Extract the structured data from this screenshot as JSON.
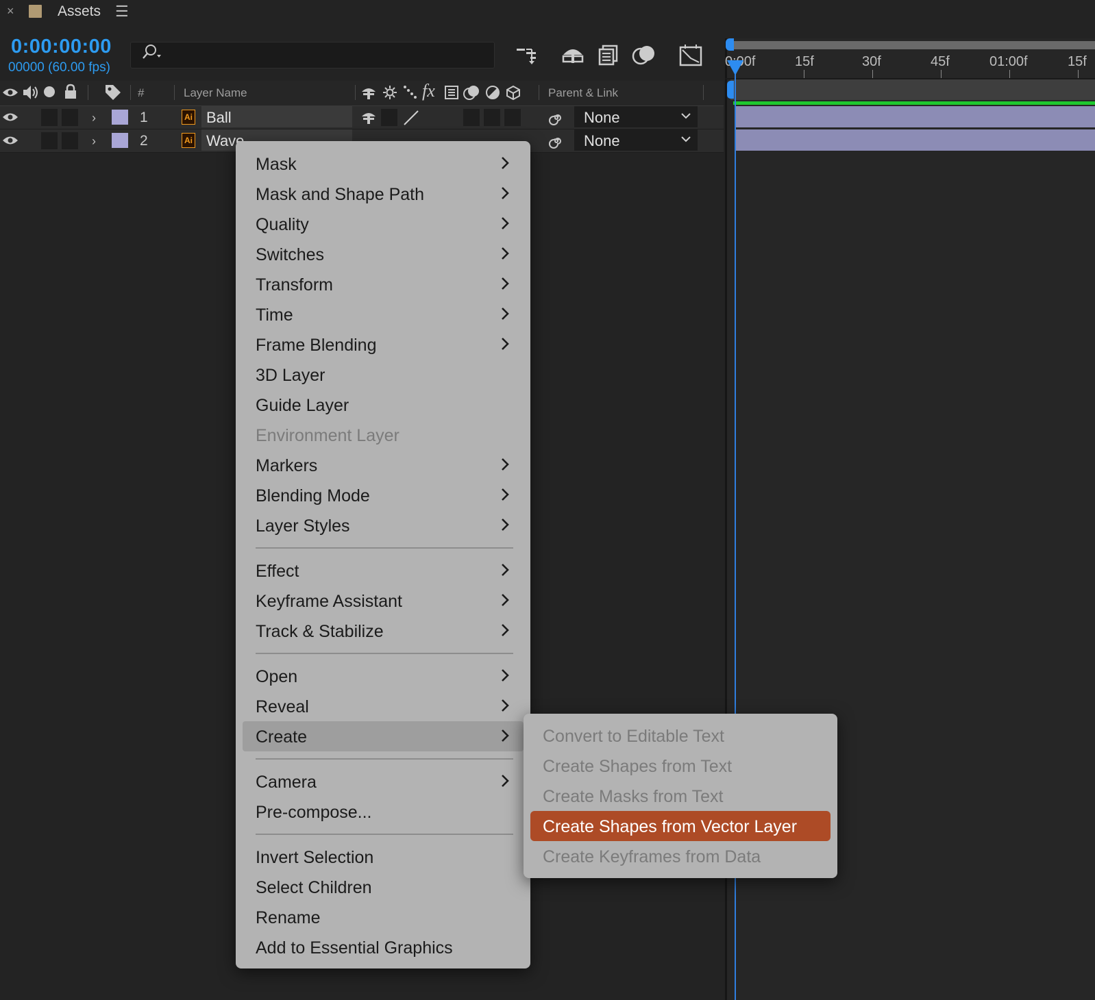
{
  "tab": {
    "title": "Assets",
    "close": "×",
    "menu": "☰"
  },
  "time": {
    "timecode": "0:00:00:00",
    "frames": "00000 (60.00 fps)"
  },
  "search": {
    "placeholder": "",
    "value": ""
  },
  "columns": {
    "hash": "#",
    "layer_name": "Layer Name",
    "parent_link": "Parent & Link"
  },
  "layers": [
    {
      "num": "1",
      "name": "Ball",
      "parent": "None",
      "label_color": "#a9a6d6"
    },
    {
      "num": "2",
      "name": "Wave",
      "parent": "None",
      "label_color": "#a9a6d6"
    }
  ],
  "ruler": [
    "0:00f",
    "15f",
    "30f",
    "45f",
    "01:00f",
    "15f"
  ],
  "menu": {
    "items": [
      {
        "label": "Mask",
        "submenu": true
      },
      {
        "label": "Mask and Shape Path",
        "submenu": true
      },
      {
        "label": "Quality",
        "submenu": true
      },
      {
        "label": "Switches",
        "submenu": true
      },
      {
        "label": "Transform",
        "submenu": true
      },
      {
        "label": "Time",
        "submenu": true
      },
      {
        "label": "Frame Blending",
        "submenu": true
      },
      {
        "label": "3D Layer",
        "submenu": false
      },
      {
        "label": "Guide Layer",
        "submenu": false
      },
      {
        "label": "Environment Layer",
        "submenu": false,
        "disabled": true
      },
      {
        "label": "Markers",
        "submenu": true
      },
      {
        "label": "Blending Mode",
        "submenu": true
      },
      {
        "label": "Layer Styles",
        "submenu": true
      },
      {
        "label": "Effect",
        "submenu": true
      },
      {
        "label": "Keyframe Assistant",
        "submenu": true
      },
      {
        "label": "Track & Stabilize",
        "submenu": true
      },
      {
        "label": "Open",
        "submenu": true
      },
      {
        "label": "Reveal",
        "submenu": true
      },
      {
        "label": "Create",
        "submenu": true,
        "highlighted": true
      },
      {
        "label": "Camera",
        "submenu": true
      },
      {
        "label": "Pre-compose...",
        "submenu": false
      },
      {
        "label": "Invert Selection",
        "submenu": false
      },
      {
        "label": "Select Children",
        "submenu": false
      },
      {
        "label": "Rename",
        "submenu": false
      },
      {
        "label": "Add to Essential Graphics",
        "submenu": false
      }
    ]
  },
  "submenu": {
    "items": [
      {
        "label": "Convert to Editable Text",
        "disabled": true
      },
      {
        "label": "Create Shapes from Text",
        "disabled": true
      },
      {
        "label": "Create Masks from Text",
        "disabled": true
      },
      {
        "label": "Create Shapes from Vector Layer",
        "highlighted": true
      },
      {
        "label": "Create Keyframes from Data",
        "disabled": true
      }
    ]
  },
  "colors": {
    "accent_blue": "#2d9bf0",
    "highlight_orange": "#ad4b26",
    "menu_bg": "#b3b3b3",
    "green_bar": "#1ec82f"
  }
}
